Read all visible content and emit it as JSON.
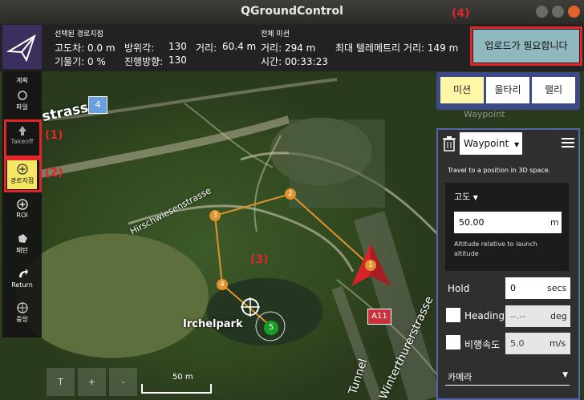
{
  "window": {
    "title": "QGroundControl"
  },
  "status": {
    "selected_header": "선택된 경로지점",
    "alt_diff": "고도차: 0.0 m",
    "gradient": "기울기: 0 %",
    "azimuth_label": "방위각:",
    "azimuth_value": "130",
    "distance_label": "거리:",
    "distance_value": "60.4 m",
    "heading_label": "진행방향:",
    "heading_value": "130",
    "mission_header": "전체 미션",
    "mission_distance": "거리: 294 m",
    "mission_time": "시간: 00:33:23",
    "max_telemetry": "최대 텔레메트리 거리: 149 m"
  },
  "upload_button": "업로드가 필요합니다",
  "annotations": {
    "a1": "(1)",
    "a2": "(2)",
    "a3": "(3)",
    "a4": "(4)"
  },
  "leftbar": {
    "plan": "계획",
    "file": "파일",
    "takeoff": "Takeoff",
    "waypoint": "경로지점",
    "roi": "ROI",
    "pattern": "패턴",
    "return": "Return",
    "center": "중앙"
  },
  "tabs": {
    "mission": "미션",
    "fence": "울타리",
    "rally": "랠리",
    "ghost": "Waypoint"
  },
  "panel": {
    "command": "Waypoint",
    "description": "Travel to a position in 3D space.",
    "altitude_label": "고도",
    "altitude_value": "50.00",
    "altitude_unit": "m",
    "altitude_note": "Altitude relative to launch altitude",
    "hold_label": "Hold",
    "hold_value": "0",
    "hold_unit": "secs",
    "heading_label": "Heading",
    "heading_value": "--.--",
    "heading_unit": "deg",
    "speed_label": "비행속도",
    "speed_value": "5.0",
    "speed_unit": "m/s",
    "camera_label": "카메라"
  },
  "map": {
    "labels": {
      "strasse": "strasse",
      "hirsch": "Hirschwiesenstrasse",
      "park": "Irchelpark",
      "winterthur": "Winterthurerstrasse",
      "tunnel": "Tunnel",
      "road4": "4",
      "a11": "A11"
    },
    "waypoints": [
      "1",
      "2",
      "3",
      "4",
      "5"
    ],
    "scale_text": "50 m",
    "buttons": {
      "t": "T",
      "plus": "+",
      "minus": "-"
    }
  },
  "colors": {
    "accent": "#3c4a88",
    "path": "#e0922b",
    "annotation": "#e0262b",
    "active_tool": "#f5e663"
  }
}
